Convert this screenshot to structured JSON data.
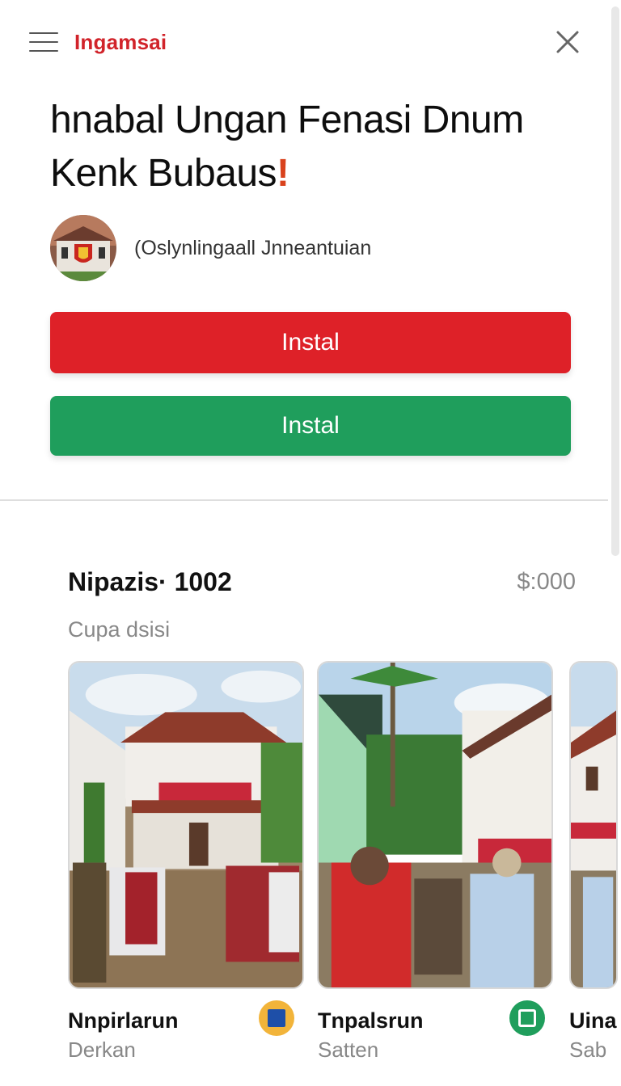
{
  "header": {
    "brand": "Ingamsai",
    "menu_icon": "hamburger-menu-icon",
    "close_icon": "close-icon"
  },
  "headline": {
    "line1": "hnabal Ungan Fenasi Dnum",
    "line2": "Kenk Bubaus",
    "alert": "!"
  },
  "publisher": {
    "name": "(Oslynlingaall Jnneantuian"
  },
  "buttons": {
    "primary_label": "Instal",
    "secondary_label": "Instal"
  },
  "section": {
    "title": "Nipazis· 1002",
    "value": "$:000",
    "subtitle": "Cupa dsisi"
  },
  "cards": [
    {
      "title": "Nnpirlarun",
      "subtitle": "Derkan",
      "badge_icon": "blue-square-icon",
      "badge_color": "#f2b43a"
    },
    {
      "title": "Tnpalsrun",
      "subtitle": "Satten",
      "badge_icon": "window-icon",
      "badge_color": "#1f9e5c"
    },
    {
      "title": "Uina",
      "subtitle": "Sab"
    }
  ],
  "colors": {
    "brand": "#d1232a",
    "primary_button": "#de2128",
    "secondary_button": "#1f9e5c",
    "muted_text": "#888888"
  }
}
